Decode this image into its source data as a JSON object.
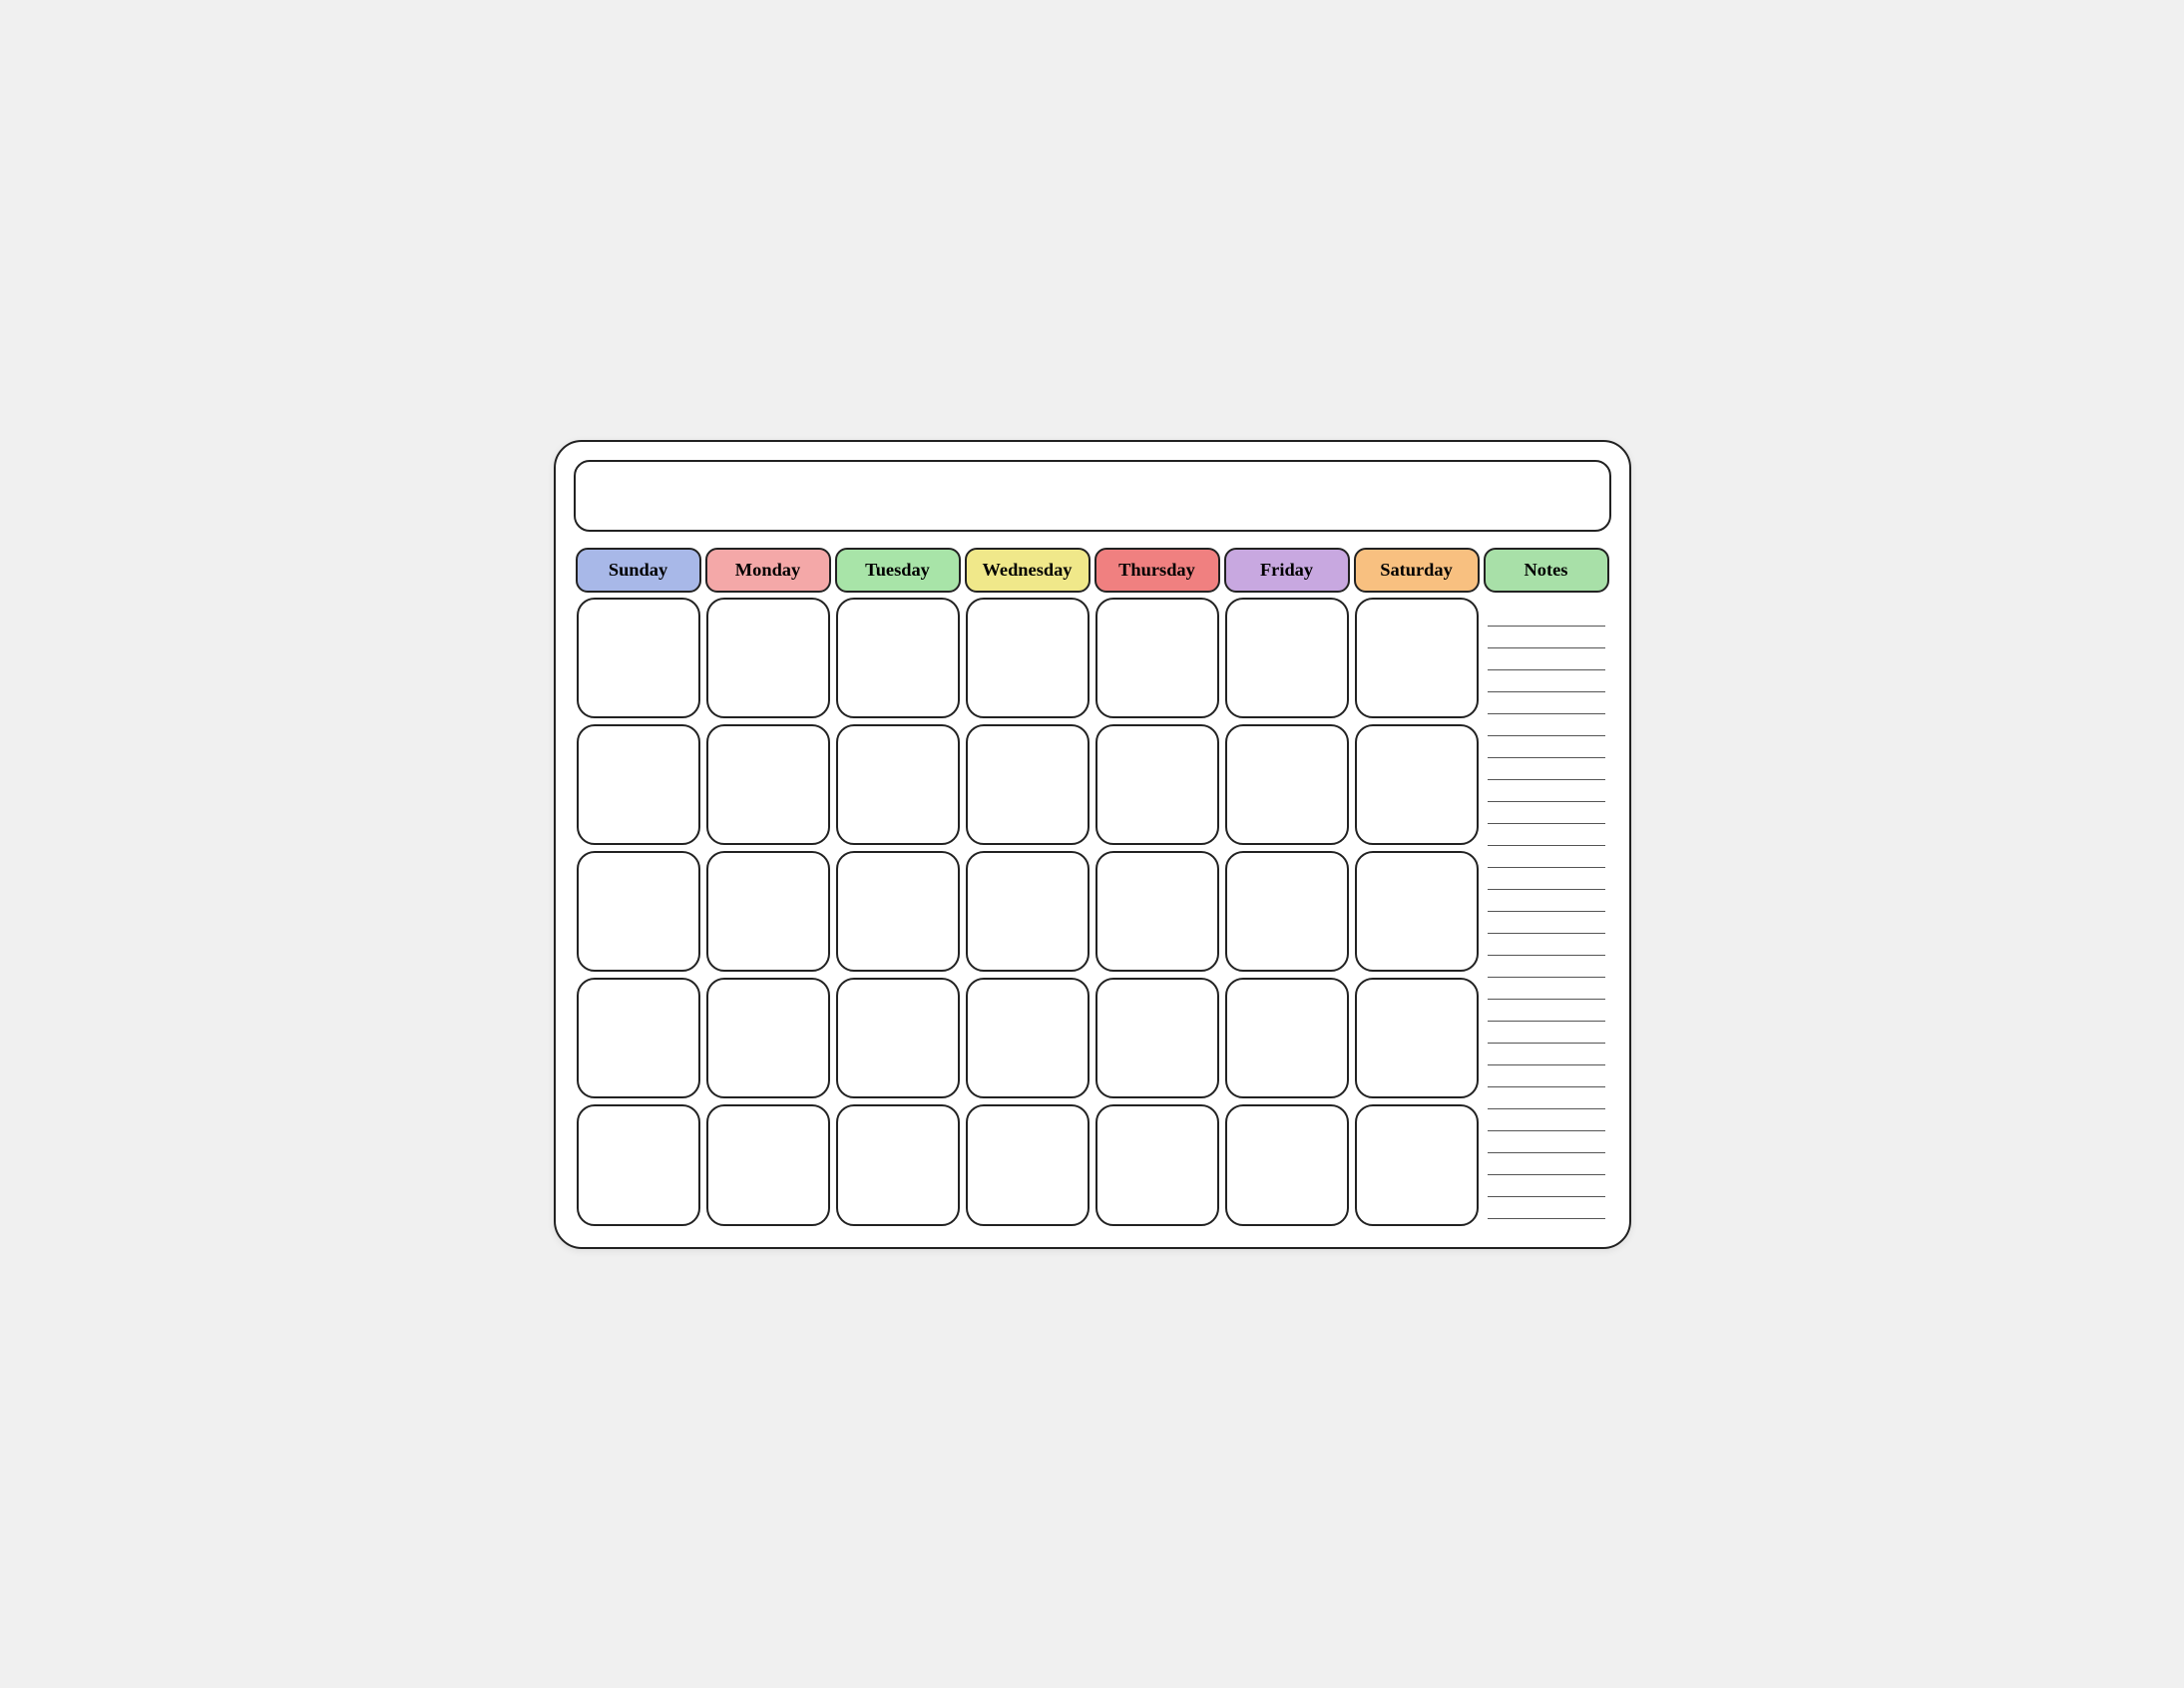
{
  "title": "",
  "headers": {
    "sunday": "Sunday",
    "monday": "Monday",
    "tuesday": "Tuesday",
    "wednesday": "Wednesday",
    "thursday": "Thursday",
    "friday": "Friday",
    "saturday": "Saturday",
    "notes": "Notes"
  },
  "weeks": 5,
  "notes_lines": 28
}
